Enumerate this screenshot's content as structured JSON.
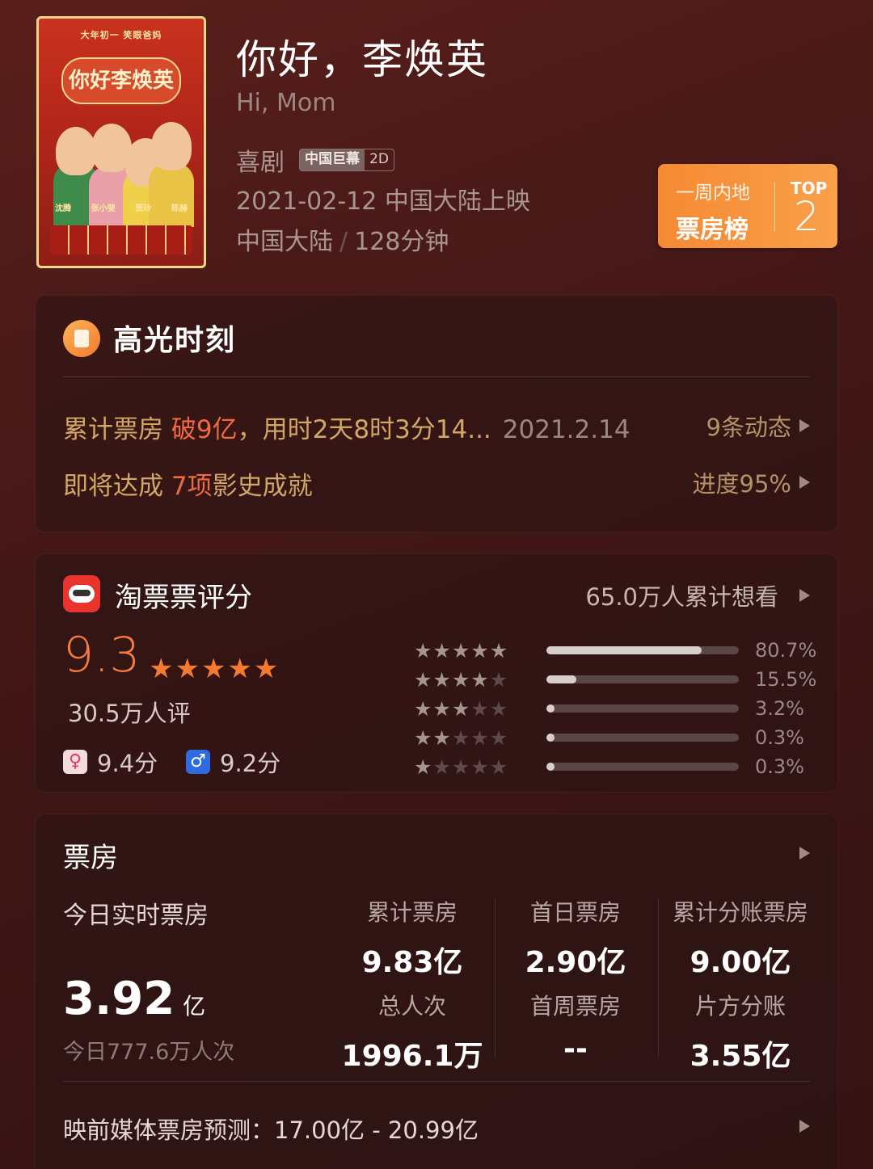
{
  "movie": {
    "title_zh": "你好，李焕英",
    "title_en": "Hi, Mom",
    "genre": "喜剧",
    "badge_format": "中国巨幕",
    "badge_dim": "2D",
    "release": "2021-02-12 中国大陆上映",
    "region": "中国大陆",
    "duration": "128分钟"
  },
  "poster": {
    "top_text": "大年初一 笑眼爸妈",
    "title": "你好李焕英",
    "cast": [
      "沈腾",
      "张小斐",
      "贾玲",
      "陈赫"
    ]
  },
  "rank": {
    "line1": "一周内地",
    "line2": "票房榜",
    "top_label": "TOP",
    "number": "2"
  },
  "highlights": {
    "title": "高光时刻",
    "row1_prefix": "累计票房",
    "row1_hi": "破9亿",
    "row1_rest": "，用时2天8时3分14...",
    "row1_date": "2021.2.14",
    "row1_link": "9条动态",
    "row2_prefix": "即将达成",
    "row2_hi": "7项",
    "row2_rest": "影史成就",
    "row2_link": "进度95%"
  },
  "rating": {
    "title": "淘票票评分",
    "want_to_see": "65.0万人累计想看",
    "score": "9.3",
    "stars": "★★★★★",
    "count": "30.5万人评",
    "female_score": "9.4分",
    "male_score": "9.2分",
    "distribution": [
      {
        "stars": 5,
        "percent": 80.7,
        "label": "80.7%"
      },
      {
        "stars": 4,
        "percent": 15.5,
        "label": "15.5%"
      },
      {
        "stars": 3,
        "percent": 3.2,
        "label": "3.2%"
      },
      {
        "stars": 2,
        "percent": 0.3,
        "label": "0.3%"
      },
      {
        "stars": 1,
        "percent": 0.3,
        "label": "0.3%"
      }
    ]
  },
  "boxoffice": {
    "title": "票房",
    "today_label": "今日实时票房",
    "today_value": "3.92",
    "today_unit": "亿",
    "today_people": "今日777.6万人次",
    "stats": {
      "cumulative_label": "累计票房",
      "cumulative_value": "9.83亿",
      "first_day_label": "首日票房",
      "first_day_value": "2.90亿",
      "split_cumulative_label": "累计分账票房",
      "split_cumulative_value": "9.00亿",
      "total_people_label": "总人次",
      "total_people_value": "1996.1万",
      "first_week_label": "首周票房",
      "first_week_value": "--",
      "producer_split_label": "片方分账",
      "producer_split_value": "3.55亿"
    },
    "forecast": "映前媒体票房预测：17.00亿 - 20.99亿"
  },
  "colors": {
    "accent_orange": "#f27a3d",
    "gold_text": "#d2a763",
    "background": "#4a1a18"
  }
}
